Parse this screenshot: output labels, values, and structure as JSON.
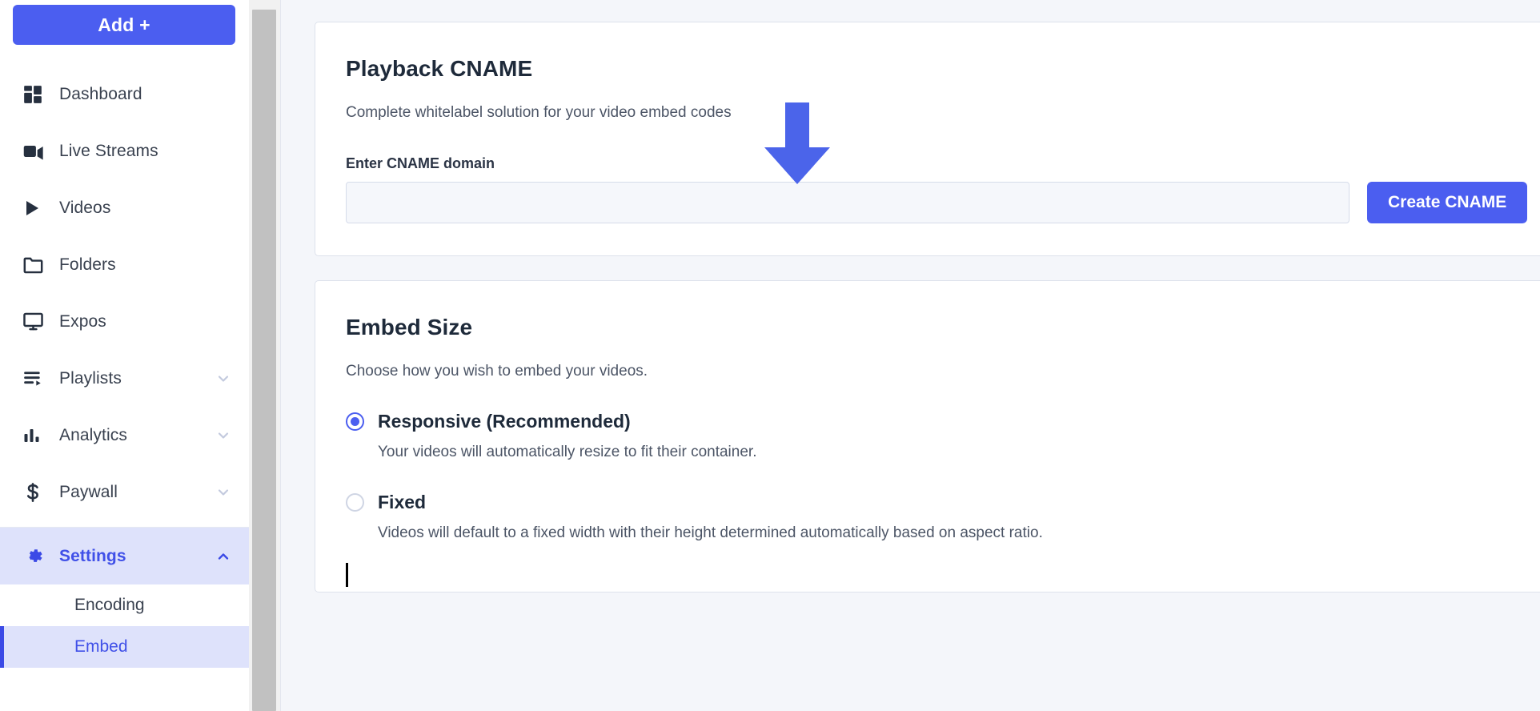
{
  "sidebar": {
    "add_button": "Add +",
    "items": [
      {
        "label": "Dashboard",
        "icon": "dashboard-grid-icon",
        "chevron": ""
      },
      {
        "label": "Live Streams",
        "icon": "video-camera-icon",
        "chevron": ""
      },
      {
        "label": "Videos",
        "icon": "play-triangle-icon",
        "chevron": ""
      },
      {
        "label": "Folders",
        "icon": "folder-icon",
        "chevron": ""
      },
      {
        "label": "Expos",
        "icon": "monitor-icon",
        "chevron": ""
      },
      {
        "label": "Playlists",
        "icon": "playlist-icon",
        "chevron": "chevron-down-icon"
      },
      {
        "label": "Analytics",
        "icon": "bar-chart-icon",
        "chevron": "chevron-down-icon"
      },
      {
        "label": "Paywall",
        "icon": "dollar-sign-icon",
        "chevron": "chevron-down-icon"
      }
    ],
    "settings": {
      "label": "Settings",
      "icon": "gear-icon",
      "chevron": "chevron-up-icon",
      "expanded": true,
      "sub_items": [
        {
          "label": "Encoding",
          "active": false
        },
        {
          "label": "Embed",
          "active": true
        }
      ]
    }
  },
  "main": {
    "cnameCard": {
      "title": "Playback CNAME",
      "subtitle": "Complete whitelabel solution for your video embed codes",
      "field_label": "Enter CNAME domain",
      "input_value": "",
      "input_placeholder": "",
      "button_label": "Create CNAME"
    },
    "embedCard": {
      "title": "Embed Size",
      "subtitle": "Choose how you wish to embed your videos.",
      "options": [
        {
          "label": "Responsive (Recommended)",
          "help": "Your videos will automatically resize to fit their container.",
          "selected": true
        },
        {
          "label": "Fixed",
          "help": "Videos will default to a fixed width with their height determined automatically based on aspect ratio.",
          "selected": false
        }
      ]
    }
  },
  "annotation": {
    "arrow": "down-arrow-annotation",
    "color": "#4b64ea"
  },
  "colors": {
    "accent": "#4b5ef0",
    "active_bg": "#dee2fb",
    "page_bg": "#f4f6fa",
    "card_bg": "#ffffff",
    "input_bg": "#f5f7fb",
    "text": "#1e2a3a",
    "muted_text": "#4c5566",
    "scrollbar_thumb": "#c1c1c1"
  }
}
